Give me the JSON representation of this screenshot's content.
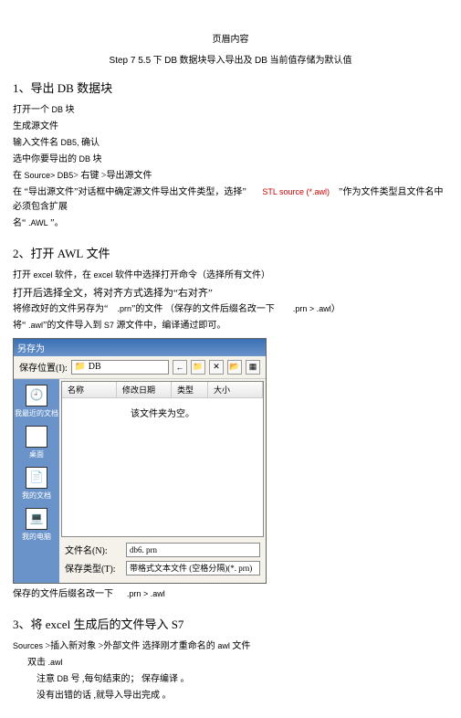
{
  "header": {
    "title": "页眉内容"
  },
  "step": {
    "prefix": "Step 7 5.5",
    "mid1": " 下 ",
    "db1": "DB",
    "mid2": " 数据块导入导出及    ",
    "db2": "DB",
    "suffix": " 当前值存储为默认值"
  },
  "sec1": {
    "title_n": "1、导出 ",
    "title_db": "DB",
    "title_suf": " 数据块",
    "l1_a": "打开一个  ",
    "l1_db": "DB",
    "l1_b": " 块",
    "l2": "生成源文件",
    "l3_a": "输入文件名  ",
    "l3_db": "DB5,",
    "l3_b": " 确认",
    "l4_a": "选中你要导出的    ",
    "l4_db": "DB",
    "l4_b": " 块",
    "l5_a": "在 ",
    "l5_b": "Source> DB5",
    "l5_c": "> 右键 >导出源文件",
    "l6_a": "在  “导出源文件”对话框中确定源文件导出文件类型，选择”",
    "l6_b": "STL source (*.awl)",
    "l6_c": "”作为文件类型且文件名中必须包含扩展",
    "l7_a": "名“ ",
    "l7_b": ".AWL",
    "l7_c": " ”。"
  },
  "sec2": {
    "title_n": "2、打开 ",
    "title_awl": "AWL",
    "title_suf": " 文件",
    "l1_a": "打开 ",
    "l1_b": "excel",
    "l1_c": " 软件，在   ",
    "l1_d": "excel",
    "l1_e": " 软件中选择打开命令（选择所有文件）",
    "l2": "打开后选择全文，将对齐方式选择为“右对齐”",
    "l3_a": "将修改好的文件另存为“",
    "l3_b": ".prn",
    "l3_c": "”的文件  （保存的文件后缀名改一下",
    "l3_d": ".prn > .awl",
    "l3_e": "）",
    "l4_a": "将“ ",
    "l4_b": ".awl",
    "l4_c": "”的文件导入到    ",
    "l4_d": "S7",
    "l4_e": " 源文件中，编译通过即可。"
  },
  "screenshot": {
    "title": "另存为",
    "save_loc_label": "保存位置(I):",
    "save_loc_value": "DB",
    "list_cols": {
      "c1": "名称",
      "c2": "修改日期",
      "c3": "类型",
      "c4": "大小"
    },
    "list_msg": "该文件夹为空。",
    "sidebar": {
      "recent": "我最近的文档",
      "desktop": "桌面",
      "mydocs": "我的文档",
      "mypc": "我的电脑"
    },
    "filename_label": "文件名(N):",
    "filename_value": "db6. prn",
    "savetype_label": "保存类型(T):",
    "savetype_value": "带格式文本文件 (空格分隔)(*. prn)"
  },
  "after_ss": {
    "l1_a": "保存的文件后缀名改一下",
    "l1_b": ".prn > .awl"
  },
  "sec3": {
    "title_n": "3、将 ",
    "title_e": "excel",
    "title_m": " 生成后的文件导入   ",
    "title_s7": "S7",
    "l1_a": "Sources",
    "l1_b": " >插入新对象   >外部文件      选择刚才重命名的    ",
    "l1_c": "awl",
    "l1_d": " 文件",
    "l2_a": "双击  ",
    "l2_b": ".awl",
    "l3_a": "注意  ",
    "l3_b": "DB",
    "l3_c": " 号 ,每句结束的；  保存编译  。",
    "l4": "没有出错的话  ,就导入导出完成  。"
  },
  "chart_data": {
    "type": "table",
    "title": "保存位置 DB — 该文件夹为空。",
    "columns": [
      "名称",
      "修改日期",
      "类型",
      "大小"
    ],
    "rows": []
  }
}
